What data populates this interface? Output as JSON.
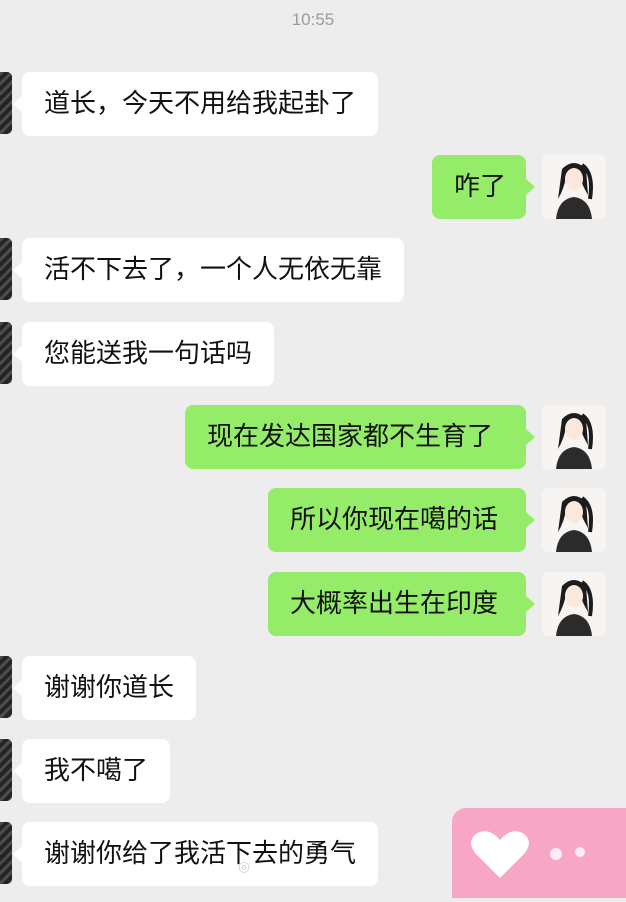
{
  "status": {
    "time": "10:55"
  },
  "messages": [
    {
      "side": "in",
      "text": "道长，今天不用给我起卦了"
    },
    {
      "side": "out",
      "text": "咋了"
    },
    {
      "side": "in",
      "text": "活不下去了，一个人无依无靠"
    },
    {
      "side": "in",
      "text": "您能送我一句话吗"
    },
    {
      "side": "out",
      "text": "现在发达国家都不生育了"
    },
    {
      "side": "out",
      "text": "所以你现在噶的话"
    },
    {
      "side": "out",
      "text": "大概率出生在印度"
    },
    {
      "side": "in",
      "text": "谢谢你道长"
    },
    {
      "side": "in",
      "text": "我不噶了"
    },
    {
      "side": "in",
      "text": "谢谢你给了我活下去的勇气"
    }
  ],
  "colors": {
    "background": "#ededed",
    "incoming": "#ffffff",
    "outgoing": "#95ec69",
    "sticker": "#f7a6c6"
  },
  "icons": {
    "sender_avatar": "avatar-icon",
    "self_avatar": "girl-avatar-icon",
    "sticker": "heart-icon"
  }
}
